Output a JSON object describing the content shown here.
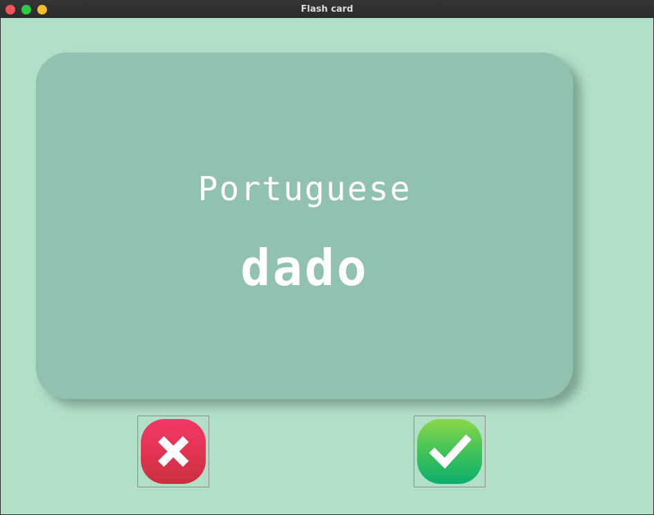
{
  "window": {
    "title": "Flash card"
  },
  "card": {
    "language": "Portuguese",
    "word": "dado"
  },
  "buttons": {
    "wrong_icon": "x-icon",
    "right_icon": "check-icon"
  },
  "colors": {
    "background": "#b1dfc8",
    "card": "#91c2b0",
    "wrong": "#e13453",
    "right": "#2dbd5c"
  }
}
